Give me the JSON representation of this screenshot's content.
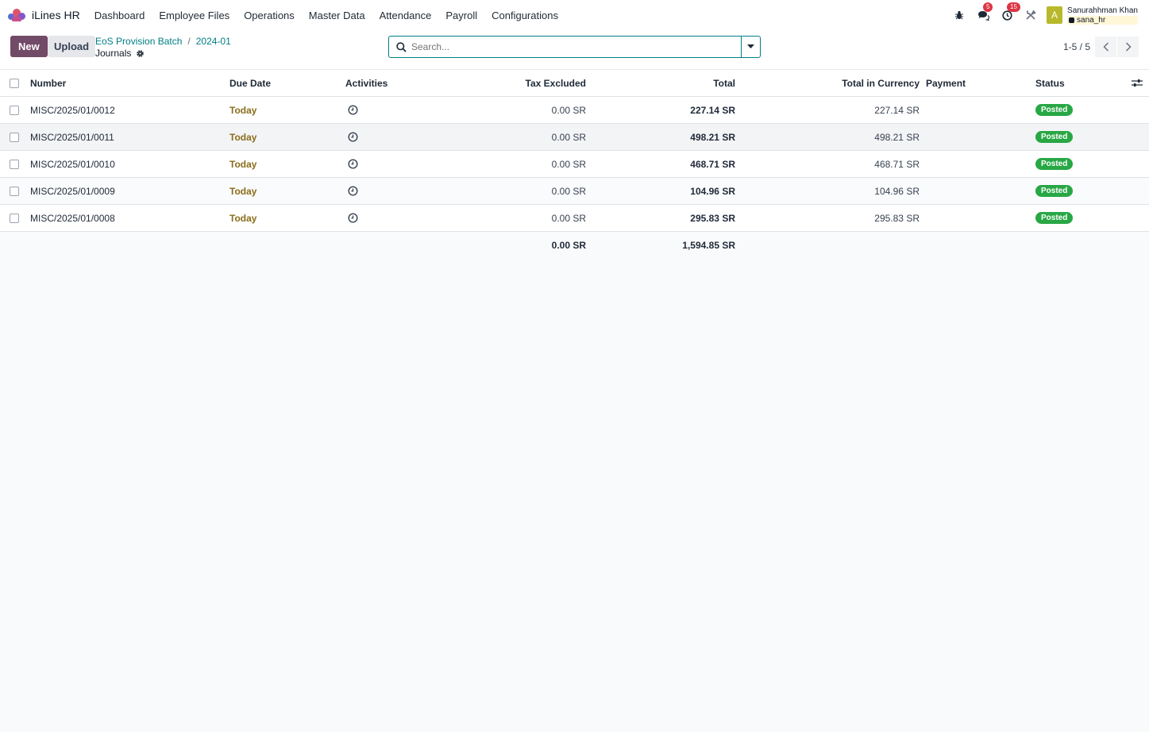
{
  "app": {
    "name": "iLines HR",
    "menu": [
      "Dashboard",
      "Employee Files",
      "Operations",
      "Master Data",
      "Attendance",
      "Payroll",
      "Configurations"
    ]
  },
  "systray": {
    "messages_count": "5",
    "activities_count": "15",
    "avatar_letter": "A",
    "user_name": "Sanurahhman Khan",
    "db_name": "sana_hr",
    "avatar_color": "#b8b92a"
  },
  "control": {
    "new_label": "New",
    "upload_label": "Upload",
    "breadcrumb": [
      "EoS Provision Batch",
      "2024-01"
    ],
    "breadcrumb_sep": "/",
    "current_title": "Journals",
    "search_placeholder": "Search...",
    "pager_text": "1-5 / 5"
  },
  "table": {
    "columns": {
      "number": "Number",
      "due_date": "Due Date",
      "activities": "Activities",
      "tax_excluded": "Tax Excluded",
      "total": "Total",
      "total_in_currency": "Total in Currency",
      "payment": "Payment",
      "status": "Status"
    },
    "rows": [
      {
        "number": "MISC/2025/01/0012",
        "due_date": "Today",
        "tax_excluded": "0.00 SR",
        "total": "227.14 SR",
        "total_in_currency": "227.14 SR",
        "payment": "",
        "status": "Posted"
      },
      {
        "number": "MISC/2025/01/0011",
        "due_date": "Today",
        "tax_excluded": "0.00 SR",
        "total": "498.21 SR",
        "total_in_currency": "498.21 SR",
        "payment": "",
        "status": "Posted"
      },
      {
        "number": "MISC/2025/01/0010",
        "due_date": "Today",
        "tax_excluded": "0.00 SR",
        "total": "468.71 SR",
        "total_in_currency": "468.71 SR",
        "payment": "",
        "status": "Posted"
      },
      {
        "number": "MISC/2025/01/0009",
        "due_date": "Today",
        "tax_excluded": "0.00 SR",
        "total": "104.96 SR",
        "total_in_currency": "104.96 SR",
        "payment": "",
        "status": "Posted"
      },
      {
        "number": "MISC/2025/01/0008",
        "due_date": "Today",
        "tax_excluded": "0.00 SR",
        "total": "295.83 SR",
        "total_in_currency": "295.83 SR",
        "payment": "",
        "status": "Posted"
      }
    ],
    "footer": {
      "tax_excluded": "0.00 SR",
      "total": "1,594.85 SR"
    }
  },
  "colors": {
    "primary": "#714b67",
    "link": "#017e84",
    "posted": "#28a745",
    "today": "#8a6d1a",
    "badge": "#dc3545"
  }
}
